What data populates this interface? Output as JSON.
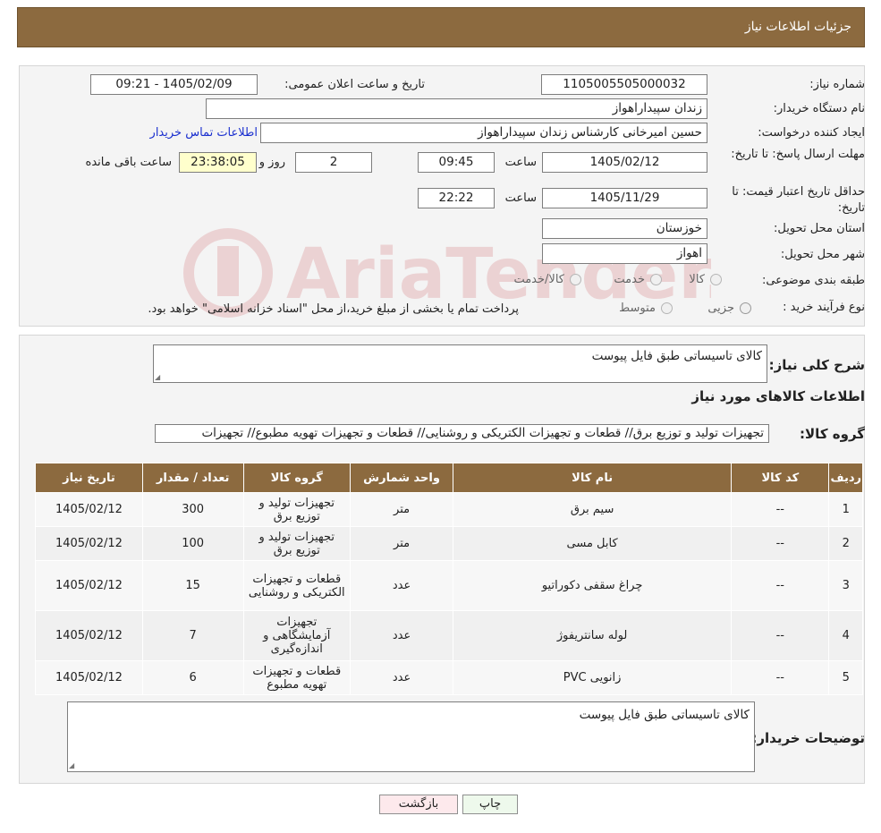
{
  "header": {
    "title": "جزئیات اطلاعات نیاز"
  },
  "need": {
    "number_label": "شماره نیاز:",
    "number": "1105005505000032",
    "announce_label": "تاریخ و ساعت اعلان عمومی:",
    "announce_value": "1405/02/09 - 09:21",
    "buyer_label": "نام دستگاه خریدار:",
    "buyer": "زندان سپیداراهواز",
    "creator_label": "ایجاد کننده درخواست:",
    "creator": "حسین امیرخانی کارشناس زندان سپیداراهواز",
    "contact_link": "اطلاعات تماس خریدار",
    "deadline_label": "مهلت ارسال پاسخ: تا تاریخ:",
    "deadline_date": "1405/02/12",
    "time_label": "ساعت",
    "deadline_time": "09:45",
    "days_value": "2",
    "days_label": "روز و",
    "remaining_time": "23:38:05",
    "remaining_label": "ساعت باقی مانده",
    "validity_label": "حداقل تاریخ اعتبار قیمت: تا تاریخ:",
    "validity_date": "1405/11/29",
    "validity_time": "22:22",
    "province_label": "استان محل تحویل:",
    "province": "خوزستان",
    "city_label": "شهر محل تحویل:",
    "city": "اهواز",
    "category_label": "طبقه بندی موضوعی:",
    "category_options": [
      "کالا",
      "خدمت",
      "کالا/خدمت"
    ],
    "process_label": "نوع فرآیند خرید :",
    "process_options": [
      "جزیی",
      "متوسط"
    ],
    "process_note": "پرداخت تمام یا بخشی از مبلغ خرید،از محل \"اسناد خزانه اسلامی\" خواهد بود."
  },
  "description": {
    "label": "شرح کلی نیاز:",
    "value": "کالای تاسیساتی طبق فایل پیوست"
  },
  "goods": {
    "heading": "اطلاعات کالاهای مورد نیاز",
    "group_label": "گروه کالا:",
    "group_value": "تجهیزات تولید و توزیع برق// قطعات و تجهیزات الکتریکی و روشنایی//  قطعات و تجهیزات تهویه مطبوع// تجهیزات",
    "columns": [
      "ردیف",
      "کد کالا",
      "نام کالا",
      "واحد شمارش",
      "گروه کالا",
      "تعداد / مقدار",
      "تاریخ نیاز"
    ],
    "rows": [
      [
        "1",
        "--",
        "سیم برق",
        "متر",
        "تجهیزات تولید و توزیع برق",
        "300",
        "1405/02/12"
      ],
      [
        "2",
        "--",
        "کابل مسی",
        "متر",
        "تجهیزات تولید و توزیع برق",
        "100",
        "1405/02/12"
      ],
      [
        "3",
        "--",
        "چراغ سقفی دکوراتیو",
        "عدد",
        "قطعات و تجهیزات الکتریکی و روشنایی",
        "15",
        "1405/02/12"
      ],
      [
        "4",
        "--",
        "لوله سانتریفوژ",
        "عدد",
        "تجهیزات آزمایشگاهی و اندازه‌گیری",
        "7",
        "1405/02/12"
      ],
      [
        "5",
        "--",
        "زانویی PVC",
        "عدد",
        "قطعات و تجهیزات تهویه مطبوع",
        "6",
        "1405/02/12"
      ]
    ]
  },
  "buyer_notes": {
    "label": "توضیحات خریدار:",
    "value": "کالای تاسیساتی طبق فایل پیوست"
  },
  "buttons": {
    "print": "چاپ",
    "back": "بازگشت"
  },
  "watermark": "AriaTender.neT"
}
